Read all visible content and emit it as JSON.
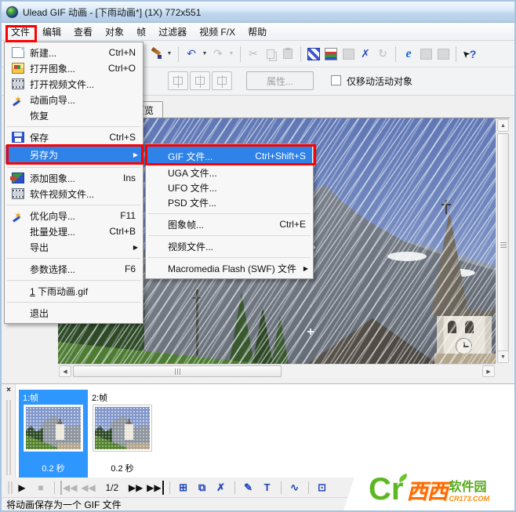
{
  "window": {
    "title": "Ulead GIF 动画 - [下雨动画*] (1X) 772x551"
  },
  "menubar": {
    "items": [
      "文件",
      "编辑",
      "查看",
      "对象",
      "帧",
      "过滤器",
      "视频 F/X",
      "帮助"
    ]
  },
  "toolbar": {
    "properties_button": "属性...",
    "move_only_label": "仅移动活动对象"
  },
  "tabs": {
    "preview": "预览"
  },
  "file_menu": {
    "items": [
      {
        "label": "新建...",
        "shortcut": "Ctrl+N"
      },
      {
        "label": "打开图象...",
        "shortcut": "Ctrl+O"
      },
      {
        "label": "打开视频文件...",
        "shortcut": ""
      },
      {
        "label": "动画向导...",
        "shortcut": ""
      },
      {
        "label": "恢复",
        "shortcut": ""
      },
      {
        "label": "保存",
        "shortcut": "Ctrl+S"
      },
      {
        "label": "另存为",
        "shortcut": ""
      },
      {
        "label": "添加图象...",
        "shortcut": "Ins"
      },
      {
        "label": "软件视频文件...",
        "shortcut": ""
      },
      {
        "label": "优化向导...",
        "shortcut": "F11"
      },
      {
        "label": "批量处理...",
        "shortcut": "Ctrl+B"
      },
      {
        "label": "导出",
        "shortcut": ""
      },
      {
        "label": "参数选择...",
        "shortcut": "F6"
      },
      {
        "label": "1 下雨动画.gif",
        "shortcut": ""
      },
      {
        "label": "退出",
        "shortcut": ""
      }
    ]
  },
  "submenu": {
    "items": [
      {
        "label": "GIF 文件...",
        "shortcut": "Ctrl+Shift+S"
      },
      {
        "label": "UGA 文件...",
        "shortcut": ""
      },
      {
        "label": "UFO 文件...",
        "shortcut": ""
      },
      {
        "label": "PSD 文件...",
        "shortcut": ""
      },
      {
        "label": "图象帧...",
        "shortcut": "Ctrl+E"
      },
      {
        "label": "视频文件...",
        "shortcut": ""
      },
      {
        "label": "Macromedia Flash (SWF) 文件",
        "shortcut": ""
      }
    ]
  },
  "frames": {
    "items": [
      {
        "label": "1:帧",
        "delay": "0.2 秒",
        "selected": true
      },
      {
        "label": "2:帧",
        "delay": "0.2 秒",
        "selected": false
      }
    ]
  },
  "playback": {
    "counter": "1/2"
  },
  "status": {
    "text": "将动画保存为一个 GIF 文件"
  },
  "watermark": {
    "cr": "Cr",
    "brand": "西西",
    "suffix": "软件园",
    "domain": "CR173.COM"
  },
  "icons": {
    "dropdown": "▼",
    "undo": "↶",
    "redo": "↷",
    "cut": "✂",
    "ie": "e",
    "help_arrow": "➤",
    "help_q": "?",
    "submenu_arrow": "▶",
    "wizard": "✶",
    "play": "▶",
    "stop": "■",
    "first": "◀◀",
    "prev": "◀◀",
    "next": "▶▶",
    "last": "▶▶",
    "add_frame": "⊞",
    "dup_frame": "⧉",
    "del_frame": "✗",
    "paint": "✎",
    "text_tool": "T",
    "tween": "∿",
    "window_tool": "⊡",
    "rotate": "↻",
    "close": "×",
    "up": "▲",
    "down": "▼",
    "left": "◀",
    "right": "▶"
  },
  "colors": {
    "highlight": "#2E82E8",
    "annotation": "#FF0000",
    "frame_selected": "#2E96FF",
    "titlebar": "#BDD4EC"
  }
}
